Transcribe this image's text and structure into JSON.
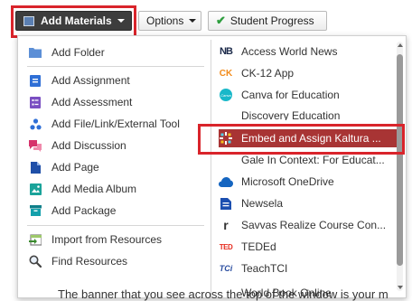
{
  "toolbar": {
    "add_materials": "Add Materials",
    "options": "Options",
    "student_progress": "Student Progress"
  },
  "menu": {
    "left": [
      {
        "label": "Add Folder",
        "icon": "folder-icon"
      },
      {
        "label": "Add Assignment",
        "icon": "assignment-icon"
      },
      {
        "label": "Add Assessment",
        "icon": "assessment-icon"
      },
      {
        "label": "Add File/Link/External Tool",
        "icon": "file-link-icon"
      },
      {
        "label": "Add Discussion",
        "icon": "discussion-icon"
      },
      {
        "label": "Add Page",
        "icon": "page-icon"
      },
      {
        "label": "Add Media Album",
        "icon": "media-album-icon"
      },
      {
        "label": "Add Package",
        "icon": "package-icon"
      },
      {
        "label": "Import from Resources",
        "icon": "import-icon"
      },
      {
        "label": "Find Resources",
        "icon": "find-icon"
      }
    ],
    "right": [
      {
        "label": "Access World News",
        "icon": "nb-logo-icon",
        "logo_text": "NB"
      },
      {
        "label": "CK-12 App",
        "icon": "ck12-logo-icon",
        "logo_text": "CK"
      },
      {
        "label": "Canva for Education",
        "icon": "canva-logo-icon",
        "logo_text": "Canva"
      },
      {
        "label": "Discovery Education",
        "icon": "discovery-logo-icon"
      },
      {
        "label": "Embed and Assign Kaltura ...",
        "icon": "kaltura-logo-icon",
        "active": true
      },
      {
        "label": "Gale In Context: For Educat...",
        "icon": "gale-logo-icon"
      },
      {
        "label": "Microsoft OneDrive",
        "icon": "onedrive-logo-icon"
      },
      {
        "label": "Newsela",
        "icon": "newsela-logo-icon"
      },
      {
        "label": "Savvas Realize Course Con...",
        "icon": "savvas-logo-icon",
        "logo_text": "r"
      },
      {
        "label": "TEDEd",
        "icon": "teded-logo-icon",
        "logo_text": "TED"
      },
      {
        "label": "TeachTCI",
        "icon": "tci-logo-icon",
        "logo_text": "TCi"
      },
      {
        "label": "World Book Online",
        "icon": "worldbook-logo-icon"
      }
    ]
  },
  "background_text": "The banner that you see across the top of the window is your m",
  "colors": {
    "highlight": "#d9242b",
    "active_item": "#a83434",
    "add_button": "#3d3d3d",
    "check_green": "#2e9e3e"
  }
}
